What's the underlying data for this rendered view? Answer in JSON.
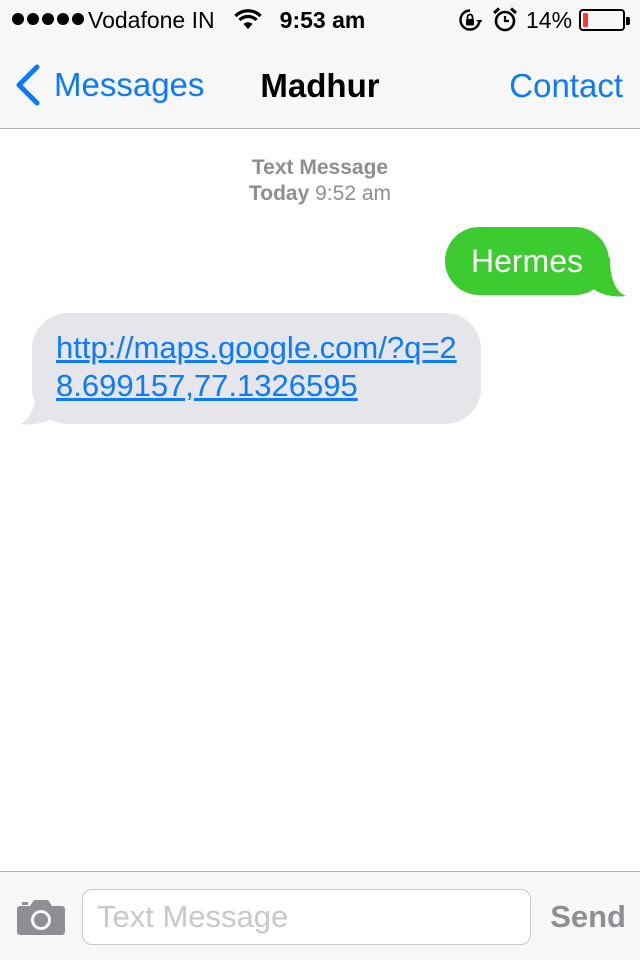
{
  "status_bar": {
    "carrier": "Vodafone IN",
    "time": "9:53 am",
    "battery_percent": "14%",
    "battery_level": 0.14,
    "signal_bars": 5,
    "icons": [
      "signal-dots-icon",
      "wifi-icon",
      "rotation-lock-icon",
      "alarm-icon",
      "battery-icon"
    ],
    "battery_color": "#ff3b30"
  },
  "nav": {
    "back_label": "Messages",
    "title": "Madhur",
    "contact_label": "Contact",
    "accent_color": "#0a7aff"
  },
  "thread": {
    "type_label": "Text Message",
    "day": "Today",
    "time": "9:52 am",
    "messages": [
      {
        "direction": "outgoing",
        "text": "Hermes",
        "bubble_color": "#3dcc2f"
      },
      {
        "direction": "incoming",
        "text": "http://maps.google.com/?q=28.699157,77.1326595",
        "bubble_color": "#e5e5ea",
        "is_link": true
      }
    ]
  },
  "composer": {
    "placeholder": "Text Message",
    "value": "",
    "send_label": "Send"
  }
}
